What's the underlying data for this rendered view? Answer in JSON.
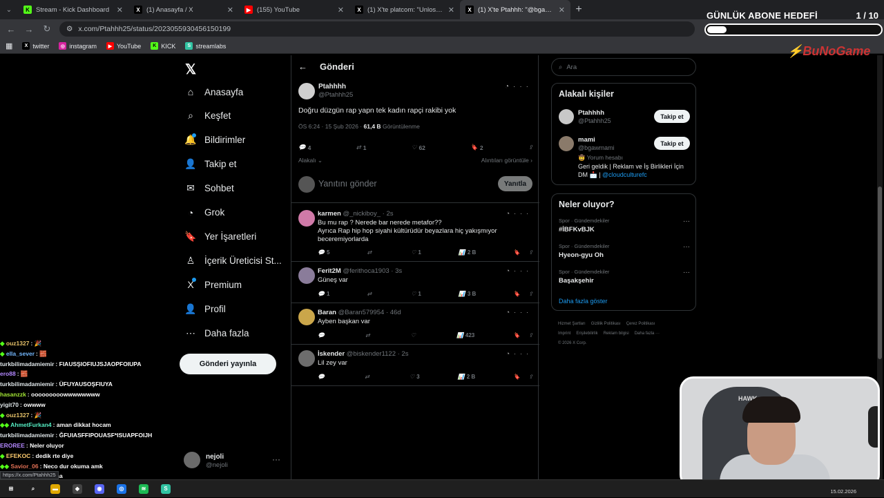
{
  "browser": {
    "tabs": [
      {
        "title": "Stream - Kick Dashboard",
        "icon": "kick-icon",
        "color": "#53fc18",
        "glyph": "K",
        "active": false
      },
      {
        "title": "(1) Anasayfa / X",
        "icon": "x-icon",
        "color": "#000000",
        "glyph": "X",
        "active": false
      },
      {
        "title": "(155) YouTube",
        "icon": "youtube-icon",
        "color": "#ff0000",
        "glyph": "▶",
        "active": false
      },
      {
        "title": "(1) X'te platcom: \"Unlost, Ichbi",
        "icon": "x-icon",
        "color": "#000000",
        "glyph": "X",
        "active": false
      },
      {
        "title": "(1) X'te Ptahhh: \"@bgawmam",
        "icon": "x-icon",
        "color": "#000000",
        "glyph": "X",
        "active": true
      }
    ],
    "url": "x.com/Ptahhh25/status/2023055930456150199",
    "bookmarks": [
      {
        "label": "twitter",
        "icon": "x-icon",
        "color": "#000",
        "glyph": "X"
      },
      {
        "label": "instagram",
        "icon": "instagram-icon",
        "color": "#d6249f",
        "glyph": "◎"
      },
      {
        "label": "YouTube",
        "icon": "youtube-icon",
        "color": "#ff0000",
        "glyph": "▶"
      },
      {
        "label": "KICK",
        "icon": "kick-icon",
        "color": "#53fc18",
        "glyph": "K"
      },
      {
        "label": "streamlabs",
        "icon": "streamlabs-icon",
        "color": "#31c3a2",
        "glyph": "S"
      }
    ]
  },
  "overlay": {
    "goal_title": "GÜNLÜK ABONE HEDEFİ",
    "goal_count": "1 / 10",
    "goal_fraction": 0.1,
    "brand_logo": "BuNoGame"
  },
  "sidebar": {
    "items": [
      {
        "label": "Anasayfa",
        "icon": "home-icon",
        "glyph": "⌂"
      },
      {
        "label": "Keşfet",
        "icon": "search-icon",
        "glyph": "⌕"
      },
      {
        "label": "Bildirimler",
        "icon": "bell-icon",
        "glyph": "🔔"
      },
      {
        "label": "Takip et",
        "icon": "person-add-icon",
        "glyph": "👤"
      },
      {
        "label": "Sohbet",
        "icon": "mail-icon",
        "glyph": "✉"
      },
      {
        "label": "Grok",
        "icon": "grok-icon",
        "glyph": "◔"
      },
      {
        "label": "Yer İşaretleri",
        "icon": "bookmark-icon",
        "glyph": "🔖"
      },
      {
        "label": "İçerik Üreticisi St...",
        "icon": "creator-studio-icon",
        "glyph": "♙"
      },
      {
        "label": "Premium",
        "icon": "x-premium-icon",
        "glyph": "X"
      },
      {
        "label": "Profil",
        "icon": "profile-icon",
        "glyph": "👤"
      },
      {
        "label": "Daha fazla",
        "icon": "more-circle-icon",
        "glyph": "⋯"
      }
    ],
    "post_button": "Gönderi yayınla",
    "account": {
      "name": "nejoli",
      "handle": "@nejoli"
    }
  },
  "main": {
    "header": "Gönderi",
    "post": {
      "name": "Ptahhhh",
      "handle": "@Ptahhh25",
      "text": "Doğru düzgün rap yapn tek kadın rapçi rakibi yok",
      "time": "ÖS 6:24 · 15 Şub 2026 ·",
      "views": "61,4 B",
      "views_label": "Görüntülenme",
      "replies": "4",
      "reposts": "1",
      "likes": "62",
      "bookmarks": "2",
      "relevance": "Alakalı",
      "quotes_link": "Alıntıları görüntüle"
    },
    "reply_placeholder": "Yanıtını gönder",
    "reply_button": "Yanıtla",
    "comments": [
      {
        "name": "karmen",
        "handle": "@_nickiboy_",
        "age": "· 2s",
        "text": "Bu mu rap ? Nerede bar nerede metafor??\nAyrıca Rap hip hop siyahi kültürüdür beyazlara hiç yakışmıyor\nbeceremiyorlarda",
        "replies": "5",
        "reposts": "",
        "likes": "1",
        "views": "2 B",
        "avatar_color": "#d07aa8"
      },
      {
        "name": "Ferit2M",
        "handle": "@ferithoca1903",
        "age": "· 3s",
        "text": "Güneş var",
        "replies": "1",
        "reposts": "",
        "likes": "1",
        "views": "3 B",
        "avatar_color": "#8a7c9a"
      },
      {
        "name": "Baran",
        "handle": "@Baran579954",
        "age": "· 46d",
        "text": "Ayben başkan var",
        "replies": "",
        "reposts": "",
        "likes": "",
        "views": "423",
        "avatar_color": "#caa64a"
      },
      {
        "name": "İskender",
        "handle": "@biskender1122",
        "age": "· 2s",
        "text": "Lil zey var",
        "replies": "",
        "reposts": "",
        "likes": "3",
        "views": "2 B",
        "avatar_color": "#6d6d6d"
      }
    ]
  },
  "right": {
    "search_placeholder": "Ara",
    "related_title": "Alakalı kişiler",
    "people": [
      {
        "name": "Ptahhhh",
        "handle": "@Ptahhh25",
        "follow": "Takip et"
      },
      {
        "name": "mami",
        "handle": "@bgawmami",
        "follow": "Takip et",
        "extra": "🤠 Yorum hesabı",
        "bio": "Geri geldik | Reklam ve İş Birlikleri İçin DM 📩 | ",
        "bio_link": "@cloudculturefc"
      }
    ],
    "trends_title": "Neler oluyor?",
    "trends": [
      {
        "category": "Spor · Gündemdekiler",
        "name": "#İBFKvBJK"
      },
      {
        "category": "Spor · Gündemdekiler",
        "name": "Hyeon-gyu Oh"
      },
      {
        "category": "Spor · Gündemdekiler",
        "name": "Başakşehir"
      }
    ],
    "show_more": "Daha fazla göster",
    "footer": [
      "Hizmet Şartları",
      "Gizlilik Politikası",
      "Çerez Politikası",
      "Imprint",
      "Erişilebilirlik",
      "Reklam bilgisi",
      "Daha fazla ···",
      "© 2026 X Corp."
    ]
  },
  "chat": [
    {
      "user": "ouz1327",
      "color": "#e9c46a",
      "msg": "🎉",
      "badge": "◆"
    },
    {
      "user": "ella_sever",
      "color": "#74b9ff",
      "msg": "🧱",
      "badge": "◆"
    },
    {
      "user": "turkbilimadamiemir",
      "color": "#dfe6e9",
      "msg": "FIAUSŞIOFIUJSJAOPFOIUPA",
      "badge": ""
    },
    {
      "user": "ero88",
      "color": "#b388ff",
      "msg": "🧱",
      "badge": ""
    },
    {
      "user": "turkbilimadamiemir",
      "color": "#dfe6e9",
      "msg": "ÜFUYAUSOŞFIUYA",
      "badge": ""
    },
    {
      "user": "hasanzzk",
      "color": "#a3e635",
      "msg": "ooooooooowwwwwwww",
      "badge": ""
    },
    {
      "user": "yigit70",
      "color": "#dfe6e9",
      "msg": "owwww",
      "badge": ""
    },
    {
      "user": "ouz1327",
      "color": "#e9c46a",
      "msg": "🎉",
      "badge": "◆"
    },
    {
      "user": "AhmetFurkan4",
      "color": "#55efc4",
      "msg": "aman dikkat hocam",
      "badge": "◆◆"
    },
    {
      "user": "turkbilimadamiemir",
      "color": "#dfe6e9",
      "msg": "ĞFUIASFFIPOUASF*ISUAPFOIJH",
      "badge": ""
    },
    {
      "user": "EROREE",
      "color": "#b388ff",
      "msg": "Neler oluyor",
      "badge": ""
    },
    {
      "user": "EFEKOC",
      "color": "#fdcb6e",
      "msg": "dedik rte diye",
      "badge": "◆"
    },
    {
      "user": "Savior_06",
      "color": "#e17055",
      "msg": "Neco dur okuma amk",
      "badge": "◆◆"
    },
    {
      "user": "",
      "color": "#dfe6e9",
      "msg": "anlayan yok ahahahha",
      "badge": ""
    }
  ],
  "status_url": "https://x.com/Ptahhh25",
  "webcam": {
    "chair_label": "HAWK"
  },
  "taskbar": {
    "apps": [
      {
        "icon": "windows-start-icon",
        "glyph": "⊞",
        "color": "#1f1f1f"
      },
      {
        "icon": "search-icon",
        "glyph": "⌕",
        "color": "#1f1f1f"
      },
      {
        "icon": "file-explorer-icon",
        "glyph": "▬",
        "color": "#e0a800"
      },
      {
        "icon": "game-icon",
        "glyph": "◆",
        "color": "#444"
      },
      {
        "icon": "discord-icon",
        "glyph": "◉",
        "color": "#5865f2"
      },
      {
        "icon": "chrome-icon",
        "glyph": "◎",
        "color": "#1a73e8"
      },
      {
        "icon": "spotify-icon",
        "glyph": "≋",
        "color": "#1db954"
      },
      {
        "icon": "streamlabs-icon",
        "glyph": "S",
        "color": "#31c3a2"
      }
    ],
    "date": "15.02.2026"
  }
}
